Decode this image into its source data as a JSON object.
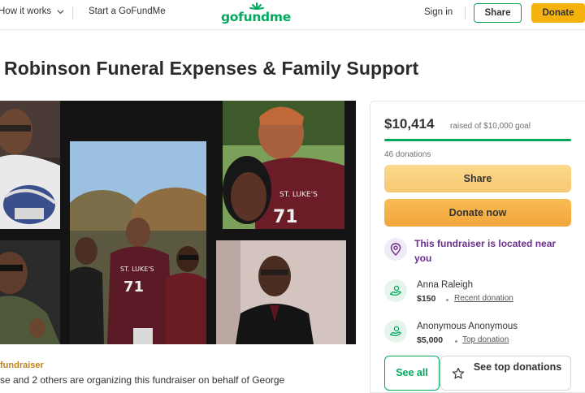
{
  "header": {
    "how_it_works": "How it works",
    "start": "Start a GoFundMe",
    "logo": "gofundme",
    "sign_in": "Sign in",
    "share": "Share",
    "donate": "Donate"
  },
  "campaign": {
    "title": "Robinson Funeral Expenses & Family Support",
    "organizer_label": "fundraiser",
    "organizer_text": "se and 2 others are organizing this fundraiser on behalf of George"
  },
  "donation_card": {
    "amount": "$10,414",
    "raised_text": "raised of $10,000 goal",
    "progress_fraction": 1.0,
    "donations_count": "46 donations",
    "share_label": "Share",
    "donate_label": "Donate now",
    "location_text": "This fundraiser is located near you",
    "donations": [
      {
        "name": "Anna Raleigh",
        "amount": "$150",
        "tag": "Recent donation"
      },
      {
        "name": "Anonymous Anonymous",
        "amount": "$5,000",
        "tag": "Top donation"
      }
    ],
    "see_all": "See all",
    "see_top": "See top donations"
  },
  "photo_texts": {
    "jersey_left": "ST. LUKE'S",
    "jersey_left_num": "71",
    "jersey_right": "ST. LUKE'S",
    "jersey_right_num": "71"
  },
  "colors": {
    "brand_green": "#02a95c",
    "donate_yellow": "#f5b20f",
    "location_purple": "#6b2e8c"
  },
  "icons": [
    "chevron-down-icon",
    "gofundme-sun-icon",
    "location-pin-icon",
    "donor-hand-icon",
    "star-icon"
  ]
}
